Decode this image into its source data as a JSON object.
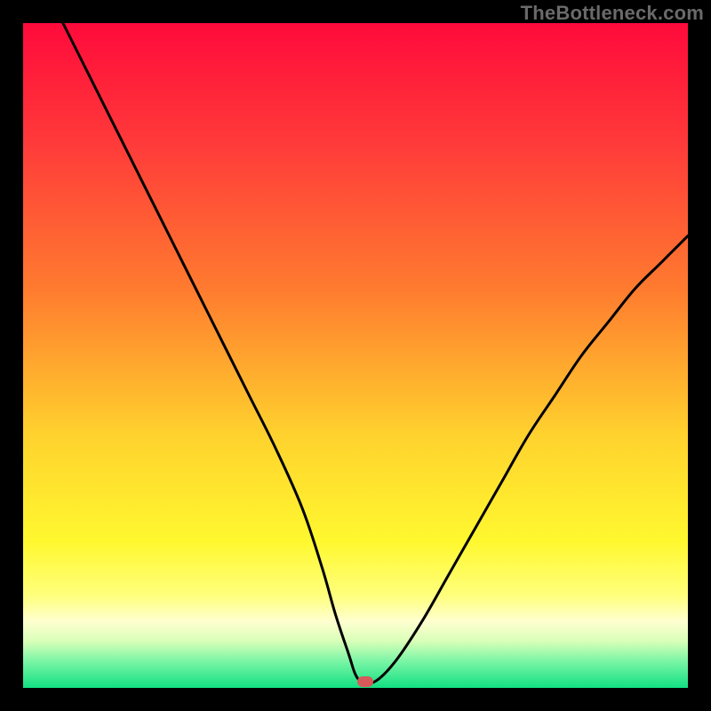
{
  "watermark": {
    "text": "TheBottleneck.com"
  },
  "marker": {
    "color": "#d65a5a",
    "x_pct": 51.5,
    "y_pct": 99.1
  },
  "gradient_stops": [
    {
      "offset": 0,
      "color": "#ff0a3b"
    },
    {
      "offset": 18,
      "color": "#ff3a3a"
    },
    {
      "offset": 40,
      "color": "#ff7b2f"
    },
    {
      "offset": 62,
      "color": "#ffd22e"
    },
    {
      "offset": 78,
      "color": "#fff82f"
    },
    {
      "offset": 86,
      "color": "#ffff7b"
    },
    {
      "offset": 90,
      "color": "#ffffd0"
    },
    {
      "offset": 93,
      "color": "#d8ffb8"
    },
    {
      "offset": 96,
      "color": "#7af5a5"
    },
    {
      "offset": 100,
      "color": "#12e083"
    }
  ],
  "chart_data": {
    "type": "line",
    "title": "",
    "xlabel": "",
    "ylabel": "",
    "xlim": [
      0,
      100
    ],
    "ylim": [
      0,
      100
    ],
    "series": [
      {
        "name": "bottleneck-curve",
        "x": [
          6,
          10,
          14,
          18,
          22,
          26,
          30,
          34,
          38,
          42,
          45,
          47,
          49,
          50,
          51,
          53,
          56,
          60,
          64,
          68,
          72,
          76,
          80,
          84,
          88,
          92,
          96,
          100
        ],
        "y": [
          100,
          92,
          84,
          76,
          68,
          60,
          52,
          44,
          36,
          27,
          18,
          11,
          5,
          2,
          1,
          1,
          4,
          10,
          17,
          24,
          31,
          38,
          44,
          50,
          55,
          60,
          64,
          68
        ]
      }
    ],
    "annotations": []
  }
}
